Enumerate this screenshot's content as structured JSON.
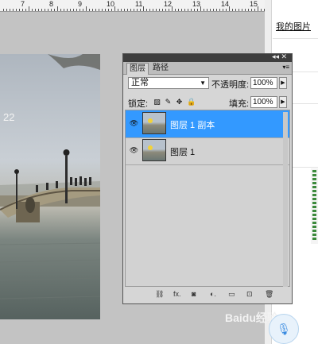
{
  "ruler": {
    "numbers": [
      "7",
      "8",
      "9",
      "10",
      "11",
      "12",
      "13",
      "14",
      "15"
    ]
  },
  "photo": {
    "date_text": "22"
  },
  "right_page": {
    "link": "我的图片"
  },
  "layers_panel": {
    "tabs": [
      {
        "label": "图层"
      },
      {
        "label": "路径"
      }
    ],
    "collapse_label": "◂◂",
    "close_label": "✕",
    "blend_mode": "正常",
    "opacity_label": "不透明度:",
    "opacity_value": "100%",
    "lock_label": "锁定:",
    "fill_label": "填充:",
    "fill_value": "100%",
    "layers": [
      {
        "name": "图层 1 副本",
        "selected": true
      },
      {
        "name": "图层 1",
        "selected": false
      }
    ],
    "bottom_icons": [
      "link-icon",
      "fx-icon",
      "mask-icon",
      "adjustment-icon",
      "folder-icon",
      "new-layer-icon",
      "trash-icon"
    ],
    "bottom_glyphs": [
      "⛓",
      "fx.",
      "◙",
      "◐.",
      "▭",
      "⊡",
      "🗑"
    ]
  },
  "watermark": "Baidu经验",
  "colors": {
    "selection": "#3399ff",
    "panel": "#d6d6d6",
    "workspace": "#c3c3c3"
  }
}
